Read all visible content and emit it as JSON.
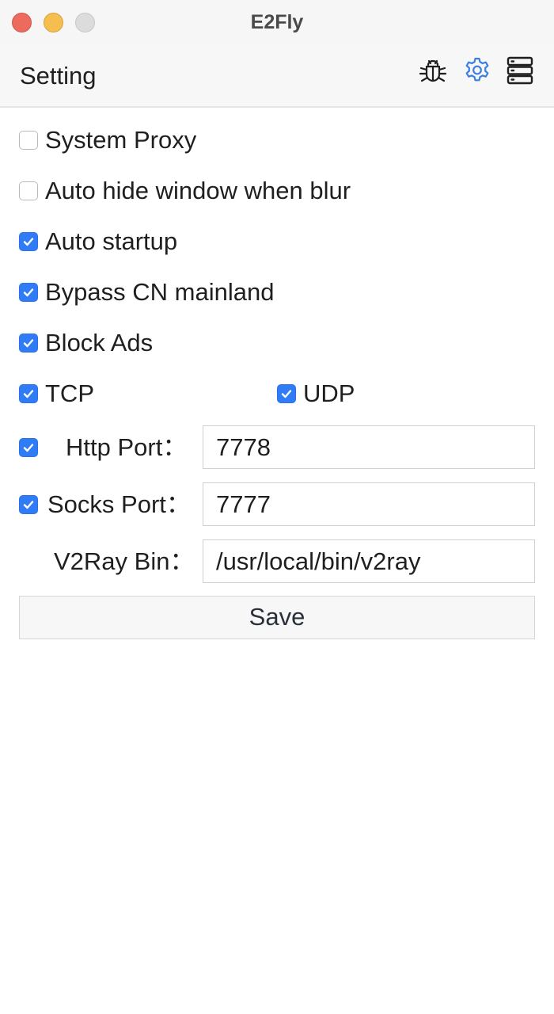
{
  "window": {
    "title": "E2Fly"
  },
  "header": {
    "title": "Setting",
    "icons": [
      "bug-icon",
      "gear-icon",
      "server-list-icon"
    ],
    "active_icon_color": "#3b7fe0"
  },
  "options": {
    "system_proxy": {
      "label": "System Proxy",
      "checked": false
    },
    "auto_hide": {
      "label": "Auto hide window when blur",
      "checked": false
    },
    "auto_startup": {
      "label": "Auto startup",
      "checked": true
    },
    "bypass_cn": {
      "label": "Bypass CN mainland",
      "checked": true
    },
    "block_ads": {
      "label": "Block Ads",
      "checked": true
    },
    "tcp": {
      "label": "TCP",
      "checked": true
    },
    "udp": {
      "label": "UDP",
      "checked": true
    }
  },
  "fields": {
    "http_port": {
      "label": "Http Port：",
      "value": "7778",
      "checked": true
    },
    "socks_port": {
      "label": "Socks Port：",
      "value": "7777",
      "checked": true
    },
    "v2ray_bin": {
      "label": "V2Ray Bin：",
      "value": "/usr/local/bin/v2ray"
    }
  },
  "save_label": "Save",
  "colors": {
    "checkbox_checked": "#2f7cf6",
    "close": "#ed6a5e",
    "minimize": "#f5be4f",
    "maximize": "#dcdcdc"
  }
}
